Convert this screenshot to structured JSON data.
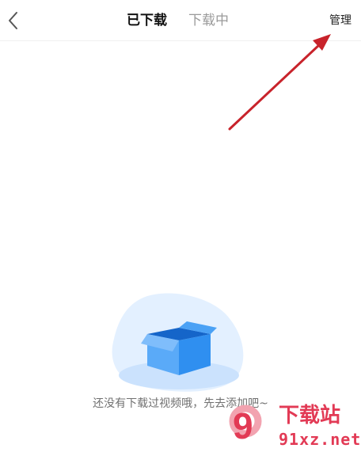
{
  "header": {
    "back_icon": "chevron-left-icon",
    "tabs": [
      {
        "label": "已下载",
        "active": true
      },
      {
        "label": "下载中",
        "active": false
      }
    ],
    "manage_label": "管理"
  },
  "empty_state": {
    "illustration_icon": "empty-box-icon",
    "message": "还没有下载过视频哦，先去添加吧~"
  },
  "annotation": {
    "arrow_color": "#c8232b"
  },
  "watermark": {
    "logo_text": "9",
    "title": "下载站",
    "url": "91xz.net",
    "color": "#e23a55"
  },
  "colors": {
    "active_tab": "#111111",
    "inactive_tab": "#9a9a9a",
    "empty_text": "#707070",
    "box_blue": "#2f8ff0"
  }
}
